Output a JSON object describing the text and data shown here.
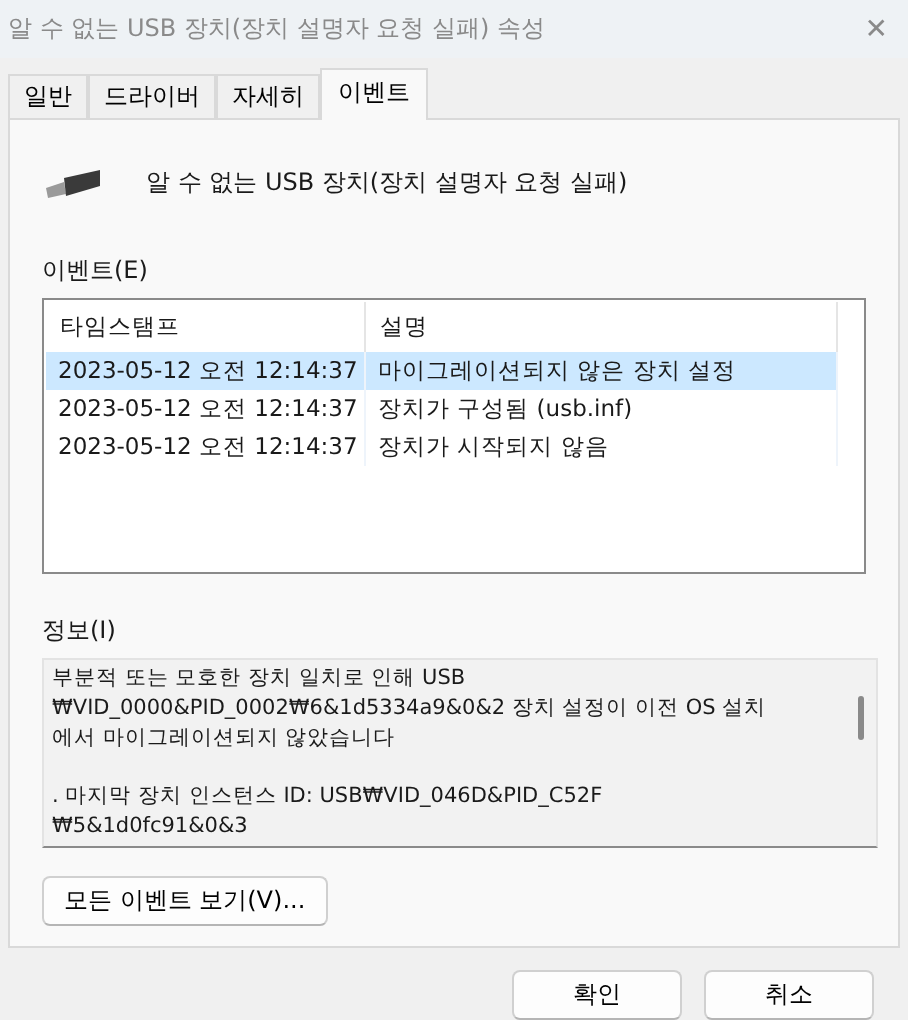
{
  "window": {
    "title": "알 수 없는 USB 장치(장치 설명자 요청 실패) 속성",
    "close": "✕"
  },
  "tabs": [
    {
      "label": "일반",
      "selected": false
    },
    {
      "label": "드라이버",
      "selected": false
    },
    {
      "label": "자세히",
      "selected": false
    },
    {
      "label": "이벤트",
      "selected": true
    }
  ],
  "device": {
    "name": "알 수 없는 USB 장치(장치 설명자 요청 실패)"
  },
  "events": {
    "label": "이벤트(E)",
    "columns": [
      "타임스탬프",
      "설명"
    ],
    "rows": [
      {
        "timestamp": "2023-05-12 오전 12:14:37",
        "description": "마이그레이션되지 않은 장치 설정",
        "selected": true
      },
      {
        "timestamp": "2023-05-12 오전 12:14:37",
        "description": "장치가 구성됨 (usb.inf)",
        "selected": false
      },
      {
        "timestamp": "2023-05-12 오전 12:14:37",
        "description": "장치가 시작되지 않음",
        "selected": false
      }
    ]
  },
  "info": {
    "label": "정보(I)",
    "paragraphs": [
      "부분적 또는 모호한 장치 일치로 인해 USB\n₩VID_0000&PID_0002₩6&1d5334a9&0&2 장치 설정이 이전 OS 설치\n에서 마이그레이션되지 않았습니다",
      ". 마지막 장치 인스턴스 ID: USB₩VID_046D&PID_C52F\n₩5&1d0fc91&0&3"
    ]
  },
  "view_all_button": "모든 이벤트 보기(V)...",
  "buttons": [
    "확인",
    "취소"
  ]
}
